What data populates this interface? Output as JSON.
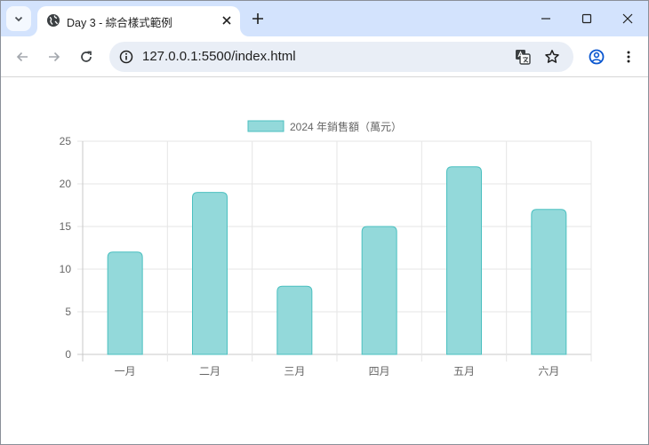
{
  "browser": {
    "tab": {
      "title": "Day 3 - 綜合樣式範例"
    },
    "address_bar": {
      "url": "127.0.0.1:5500/index.html"
    },
    "window_controls": [
      "minimize-icon",
      "maximize-icon",
      "close-icon"
    ]
  },
  "colors": {
    "tabstrip": "#d3e3fd",
    "bar_fill": "#93d9da",
    "bar_border": "#4bc0c0"
  },
  "chart_data": {
    "type": "bar",
    "categories": [
      "一月",
      "二月",
      "三月",
      "四月",
      "五月",
      "六月"
    ],
    "series": [
      {
        "name": "2024 年銷售額（萬元）",
        "values": [
          12,
          19,
          8,
          15,
          22,
          17
        ]
      }
    ],
    "ylim": [
      0,
      25
    ],
    "yticks": [
      0,
      5,
      10,
      15,
      20,
      25
    ],
    "grid": true,
    "legend": "top"
  }
}
